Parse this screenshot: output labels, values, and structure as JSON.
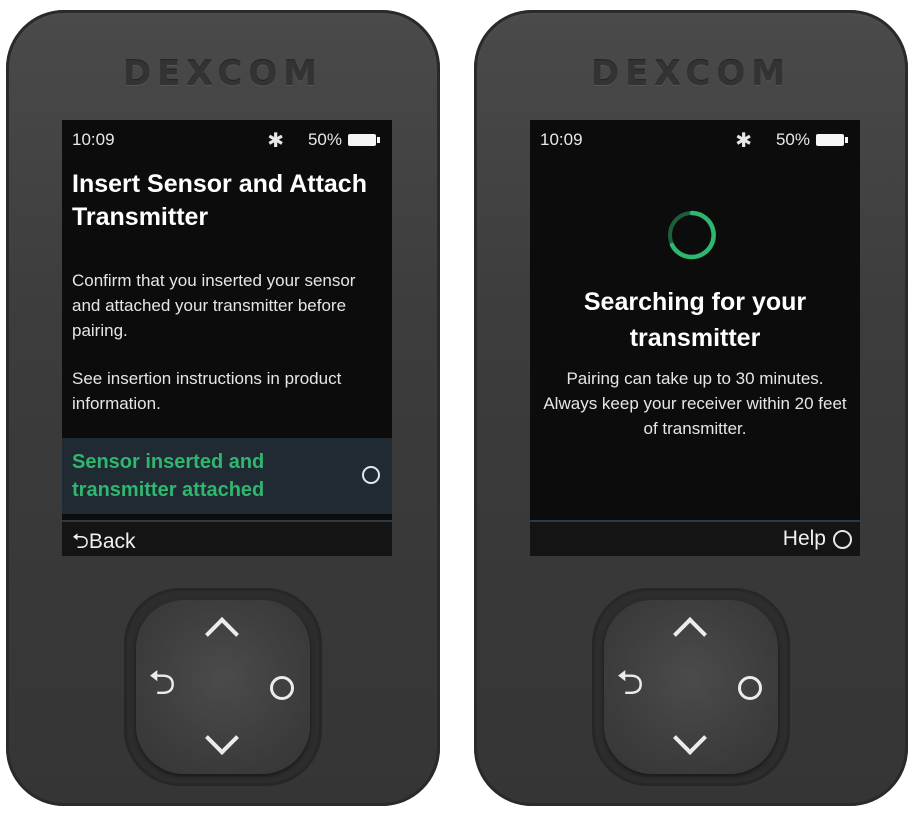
{
  "left_screen": {
    "brand": "DEXCOM",
    "status": {
      "time": "10:09",
      "bluetooth": "✱",
      "battery_pct": "50%"
    },
    "title": "Insert Sensor and Attach Transmitter",
    "paragraph1": "Confirm that you inserted your sensor and attached your transmitter before pairing.",
    "paragraph2": "See insertion instructions in product information.",
    "option_label": "Sensor inserted and transmitter attached",
    "back_label": "Back"
  },
  "right_screen": {
    "brand": "DEXCOM",
    "status": {
      "time": "10:09",
      "bluetooth": "✱",
      "battery_pct": "50%"
    },
    "title": "Searching for your transmitter",
    "paragraph": "Pairing can take up to 30 minutes. Always keep your receiver within 20 feet of transmitter.",
    "help_label": "Help"
  },
  "colors": {
    "accent_green": "#2fb66f",
    "screen_bg": "#0c0c0c",
    "selected_row_bg": "#1f2a33"
  },
  "icons": {
    "back": "back-arrow-icon",
    "select": "circle-select-icon",
    "up": "chevron-up-icon",
    "down": "chevron-down-icon",
    "spinner": "loading-spinner-icon",
    "bluetooth": "bluetooth-icon",
    "battery": "battery-icon"
  }
}
